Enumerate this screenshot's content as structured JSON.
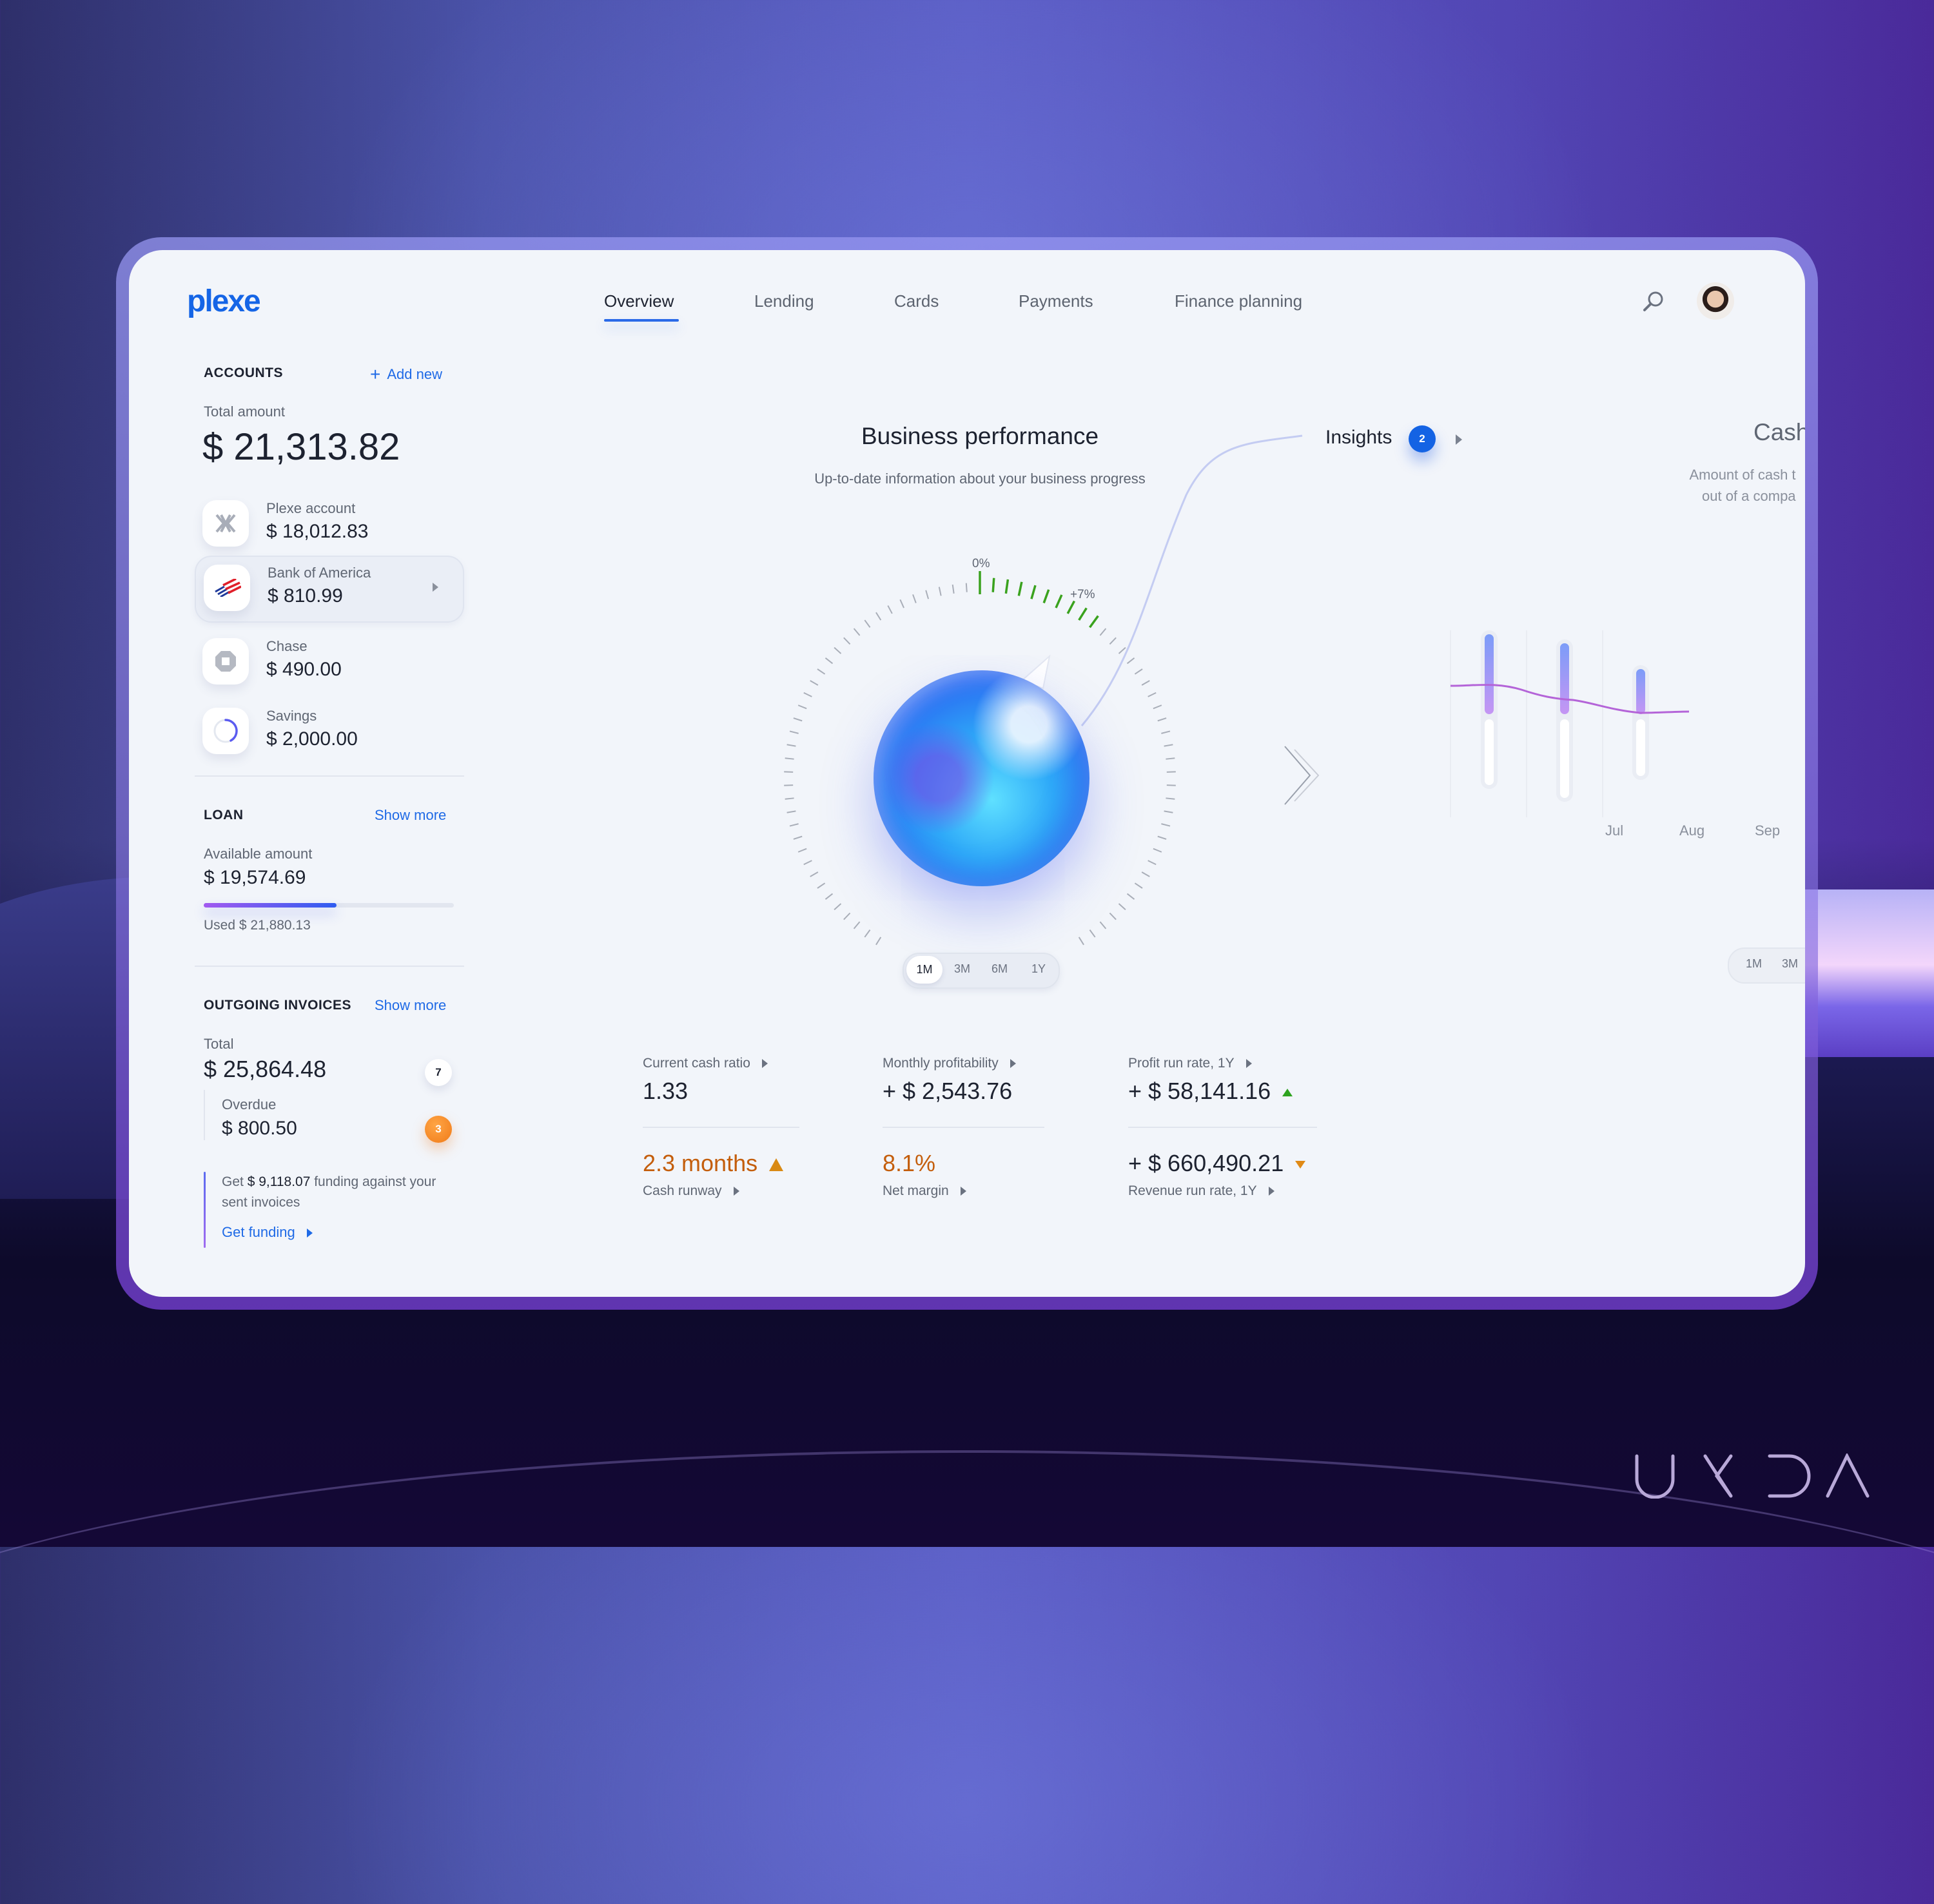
{
  "brand": {
    "logo_text": "plexe",
    "watermark": "UXDA"
  },
  "nav": {
    "items": [
      {
        "label": "Overview",
        "active": true
      },
      {
        "label": "Lending",
        "active": false
      },
      {
        "label": "Cards",
        "active": false
      },
      {
        "label": "Payments",
        "active": false
      },
      {
        "label": "Finance planning",
        "active": false
      }
    ],
    "search_icon": "search-icon",
    "avatar_icon": "user-avatar"
  },
  "accounts": {
    "title": "ACCOUNTS",
    "add_new_label": "Add new",
    "total_label": "Total amount",
    "total_value": "$ 21,313.82",
    "items": [
      {
        "name": "Plexe account",
        "amount": "$ 18,012.83",
        "icon": "plexe-x-icon",
        "selected": false
      },
      {
        "name": "Bank of America",
        "amount": "$ 810.99",
        "icon": "bank-of-america-icon",
        "selected": true
      },
      {
        "name": "Chase",
        "amount": "$ 490.00",
        "icon": "chase-icon",
        "selected": false
      },
      {
        "name": "Savings",
        "amount": "$ 2,000.00",
        "icon": "savings-ring-icon",
        "selected": false
      }
    ]
  },
  "loan": {
    "title": "LOAN",
    "show_more_label": "Show more",
    "available_label": "Available amount",
    "available_value": "$ 19,574.69",
    "used_label": "Used $ 21,880.13",
    "used_fraction": 0.53
  },
  "invoices": {
    "title": "OUTGOING INVOICES",
    "show_more_label": "Show more",
    "total_label": "Total",
    "total_value": "$ 25,864.48",
    "total_count": "7",
    "overdue_label": "Overdue",
    "overdue_value": "$ 800.50",
    "overdue_count": "3",
    "funding_prefix": "Get ",
    "funding_amount": "$ 9,118.07",
    "funding_suffix": " funding against your sent invoices",
    "get_funding_label": "Get funding"
  },
  "performance": {
    "title": "Business performance",
    "subtitle": "Up-to-date information about your business progress",
    "gauge_zero_label": "0%",
    "gauge_value_label": "+7%",
    "gauge_value_percent": 7,
    "periods": [
      "1M",
      "3M",
      "6M",
      "1Y"
    ],
    "active_period": "1M"
  },
  "insights": {
    "label": "Insights",
    "count": "2"
  },
  "metrics": [
    {
      "label": "Current cash ratio",
      "value": "1.33",
      "label_position": "top",
      "trend": "none",
      "warn": false
    },
    {
      "label": "Monthly profitability",
      "value": "+ $ 2,543.76",
      "label_position": "top",
      "trend": "none",
      "warn": false
    },
    {
      "label": "Profit run rate, 1Y",
      "value": "+ $ 58,141.16",
      "label_position": "top",
      "trend": "up",
      "warn": false
    },
    {
      "label": "Cash runway",
      "value": "2.3 months",
      "label_position": "bottom",
      "trend": "warning",
      "warn": true
    },
    {
      "label": "Net margin",
      "value": "8.1%",
      "label_position": "bottom",
      "trend": "none",
      "warn": true
    },
    {
      "label": "Revenue run rate, 1Y",
      "value": "+ $ 660,490.21",
      "label_position": "bottom",
      "trend": "down",
      "warn": false
    }
  ],
  "cashflow": {
    "title": "Cash",
    "subtitle_line1": "Amount of cash t",
    "subtitle_line2": "out of a compa",
    "months": [
      "Jul",
      "Aug",
      "Sep"
    ],
    "inflow": [
      0.62,
      0.55,
      0.35
    ],
    "outflow": [
      0.55,
      0.65,
      0.48
    ],
    "periods": [
      "1M",
      "3M"
    ]
  },
  "colors": {
    "accent": "#1f6ae6",
    "warning": "#c45e0c",
    "positive": "#2ea31f"
  }
}
